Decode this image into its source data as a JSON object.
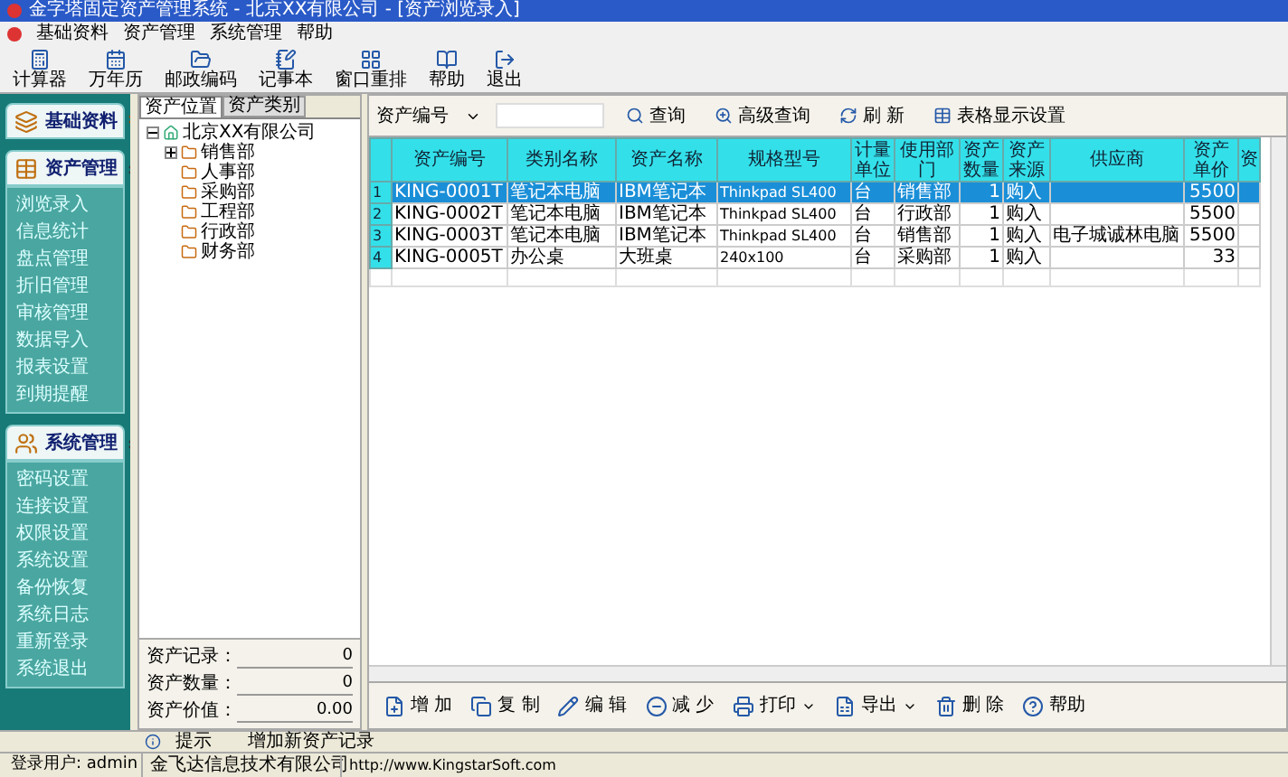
{
  "window": {
    "title": "金字塔固定资产管理系统 - 北京XX有限公司 - [资产浏览录入]"
  },
  "menu": [
    "基础资料",
    "资产管理",
    "系统管理",
    "帮助"
  ],
  "toolbar": [
    "计算器",
    "万年历",
    "邮政编码",
    "记事本",
    "窗口重排",
    "帮助",
    "退出"
  ],
  "sidebar": {
    "sections": [
      {
        "title": "基础资料",
        "expanded": false
      },
      {
        "title": "资产管理",
        "expanded": true,
        "items": [
          "浏览录入",
          "信息统计",
          "盘点管理",
          "折旧管理",
          "审核管理",
          "数据导入",
          "报表设置",
          "到期提醒"
        ]
      },
      {
        "title": "系统管理",
        "expanded": true,
        "items": [
          "密码设置",
          "连接设置",
          "权限设置",
          "系统设置",
          "备份恢复",
          "系统日志",
          "重新登录",
          "系统退出"
        ]
      }
    ]
  },
  "tree_tabs": [
    {
      "label": "资产位置",
      "selected": true
    },
    {
      "label": "资产类别",
      "selected": false
    }
  ],
  "tree": {
    "label": "北京XX有限公司",
    "expanded": true,
    "children": [
      {
        "label": "销售部",
        "kind": "branch",
        "expanded": false
      },
      {
        "label": "人事部",
        "kind": "leaf"
      },
      {
        "label": "采购部",
        "kind": "leaf"
      },
      {
        "label": "工程部",
        "kind": "leaf"
      },
      {
        "label": "行政部",
        "kind": "leaf"
      },
      {
        "label": "财务部",
        "kind": "leaf"
      }
    ]
  },
  "summary": [
    {
      "label": "资产记录：",
      "value": "0"
    },
    {
      "label": "资产数量：",
      "value": "0"
    },
    {
      "label": "资产价值：",
      "value": "0.00"
    }
  ],
  "search": {
    "field": "资产编号",
    "actions": [
      "查询",
      "高级查询",
      "刷 新",
      "表格显示设置"
    ]
  },
  "table": {
    "columns": [
      "资产编号",
      "类别名称",
      "资产名称",
      "规格型号",
      "计量单位",
      "使用部门",
      "资产数量",
      "资产来源",
      "供应商",
      "资产单价",
      "资"
    ],
    "rows": [
      {
        "number": "1",
        "selected": true,
        "asset_no": "KING-0001T",
        "category": "笔记本电脑",
        "name": "IBM笔记本",
        "model": "Thinkpad SL400",
        "unit": "台",
        "department": "销售部",
        "quantity": "1",
        "source": "购入",
        "unit_price": "5500"
      },
      {
        "number": "2",
        "selected": false,
        "asset_no": "KING-0002T",
        "category": "笔记本电脑",
        "name": "IBM笔记本",
        "model": "Thinkpad SL400",
        "unit": "台",
        "department": "行政部",
        "quantity": "1",
        "source": "购入",
        "unit_price": "5500"
      },
      {
        "number": "3",
        "selected": false,
        "asset_no": "KING-0003T",
        "category": "笔记本电脑",
        "name": "IBM笔记本",
        "model": "Thinkpad SL400",
        "unit": "台",
        "department": "销售部",
        "quantity": "1",
        "source": "购入",
        "supplier": "电子城诚林电脑",
        "unit_price": "5500"
      },
      {
        "number": "4",
        "selected": false,
        "asset_no": "KING-0005T",
        "category": "办公桌",
        "name": "大班桌",
        "model": "240x100",
        "unit": "台",
        "department": "采购部",
        "quantity": "1",
        "source": "购入",
        "unit_price": "33"
      }
    ]
  },
  "bottom_toolbar": [
    {
      "label": "增 加",
      "dropdown": false
    },
    {
      "label": "复 制",
      "dropdown": false
    },
    {
      "label": "编 辑",
      "dropdown": false
    },
    {
      "label": "减 少",
      "dropdown": false
    },
    {
      "label": "打印",
      "dropdown": true
    },
    {
      "label": "导出",
      "dropdown": true
    },
    {
      "label": "删 除",
      "dropdown": false
    },
    {
      "label": "帮助",
      "dropdown": false
    }
  ],
  "hint": {
    "label": "提示",
    "message": "增加新资产记录"
  },
  "status_bar": {
    "user": "登录用户: admin",
    "company": "金飞达信息技术有限公司",
    "url": "http://www.KingstarSoft.com"
  }
}
